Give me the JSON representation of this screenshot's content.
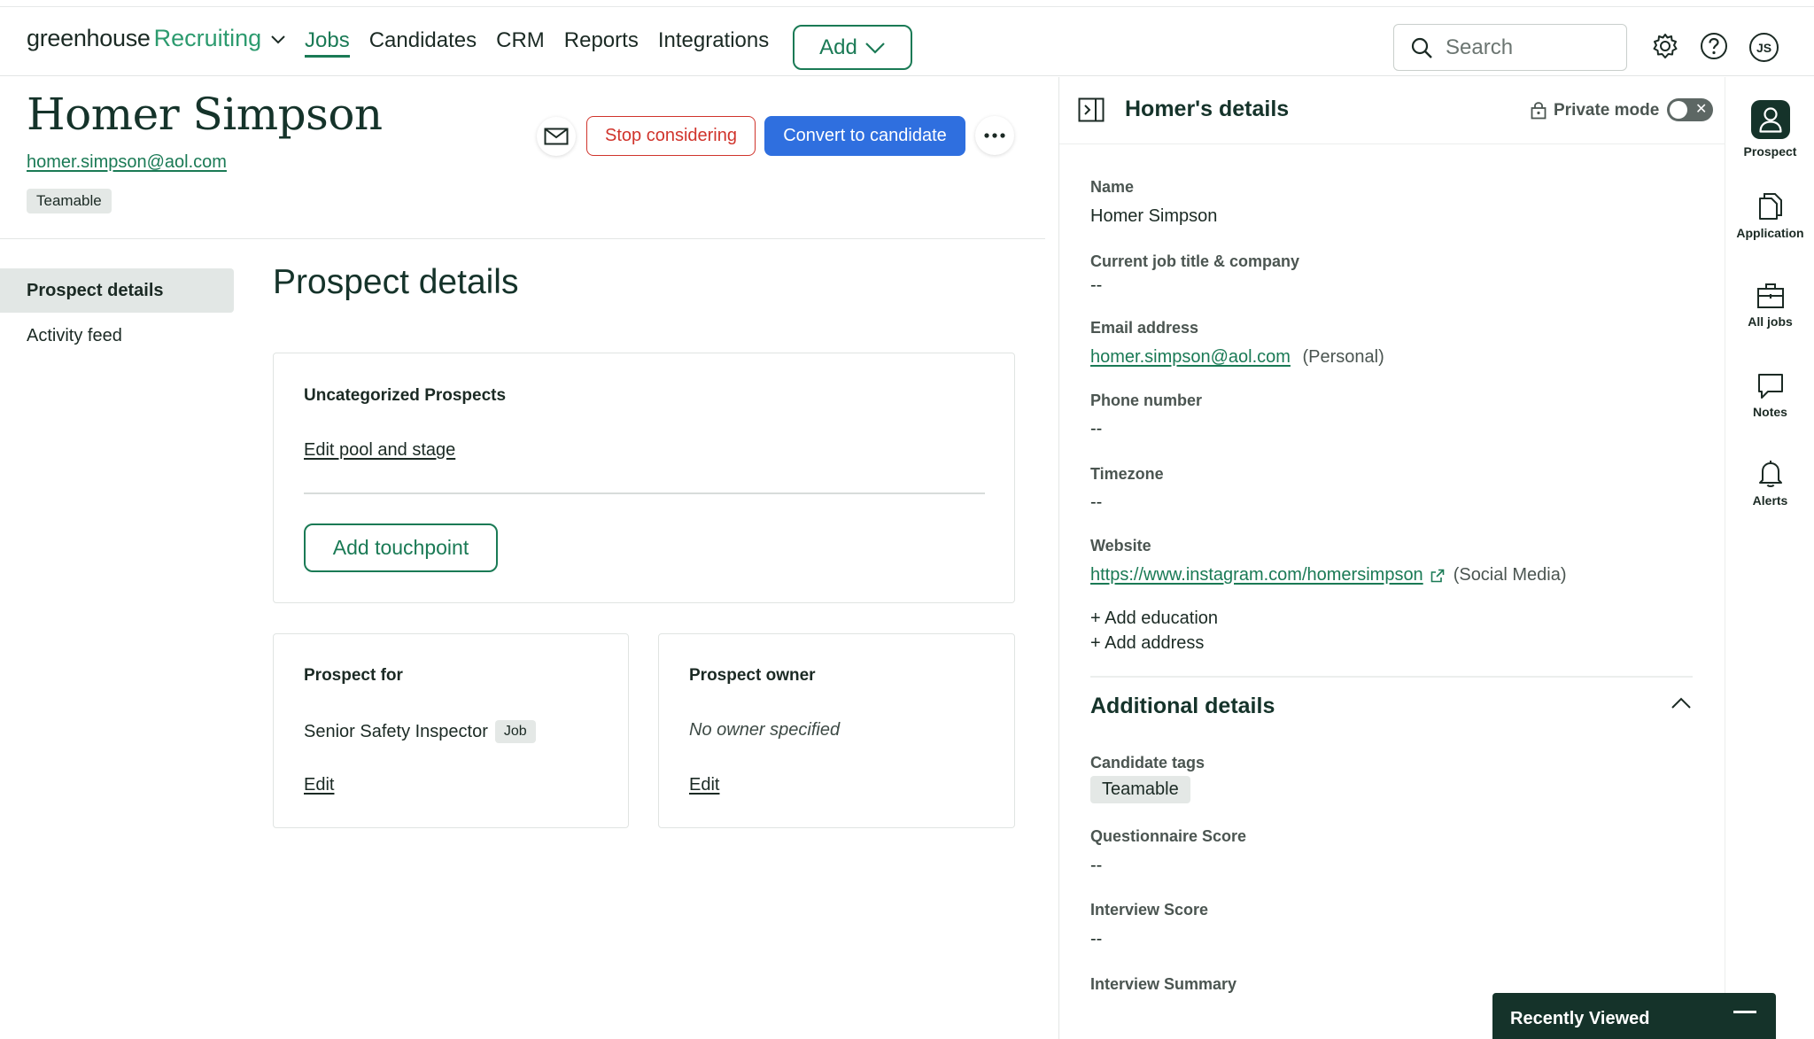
{
  "brand": {
    "name": "greenhouse",
    "product": "Recruiting"
  },
  "nav": {
    "items": [
      {
        "label": "Jobs",
        "active": true
      },
      {
        "label": "Candidates"
      },
      {
        "label": "CRM"
      },
      {
        "label": "Reports"
      },
      {
        "label": "Integrations"
      }
    ],
    "add_label": "Add",
    "search_placeholder": "Search",
    "user_initials": "JS"
  },
  "header": {
    "name": "Homer Simpson",
    "email": "homer.simpson@aol.com",
    "tag": "Teamable",
    "stop_label": "Stop considering",
    "convert_label": "Convert to candidate"
  },
  "subnav": {
    "items": [
      {
        "label": "Prospect details",
        "active": true
      },
      {
        "label": "Activity feed"
      }
    ]
  },
  "main": {
    "title": "Prospect details",
    "pool_card": {
      "title": "Uncategorized Prospects",
      "edit_link": "Edit pool and stage",
      "touchpoint_label": "Add touchpoint"
    },
    "prospect_for": {
      "title": "Prospect for",
      "job": "Senior Safety Inspector",
      "job_tag": "Job",
      "edit_link": "Edit"
    },
    "prospect_owner": {
      "title": "Prospect owner",
      "value": "No owner specified",
      "edit_link": "Edit"
    }
  },
  "details_panel": {
    "title": "Homer's details",
    "private_mode_label": "Private mode",
    "fields": {
      "name_label": "Name",
      "name_value": "Homer Simpson",
      "job_label": "Current job title & company",
      "job_value": "--",
      "email_label": "Email address",
      "email_value": "homer.simpson@aol.com",
      "email_type": "(Personal)",
      "phone_label": "Phone number",
      "phone_value": "--",
      "timezone_label": "Timezone",
      "timezone_value": "--",
      "website_label": "Website",
      "website_value": "https://www.instagram.com/homersimpson",
      "website_type": "(Social Media)"
    },
    "add_education": "+ Add education",
    "add_address": "+ Add address",
    "additional": {
      "title": "Additional details",
      "tags_label": "Candidate tags",
      "tag_value": "Teamable",
      "questionnaire_label": "Questionnaire Score",
      "questionnaire_value": "--",
      "interview_label": "Interview Score",
      "interview_value": "--",
      "summary_label": "Interview Summary"
    }
  },
  "rail": {
    "items": [
      {
        "label": "Prospect",
        "icon": "person-icon"
      },
      {
        "label": "Application",
        "icon": "documents-icon"
      },
      {
        "label": "All jobs",
        "icon": "briefcase-icon"
      },
      {
        "label": "Notes",
        "icon": "speech-bubble-icon"
      },
      {
        "label": "Alerts",
        "icon": "bell-icon"
      }
    ]
  },
  "recently_viewed": {
    "label": "Recently Viewed"
  },
  "colors": {
    "accent": "#1a7a55",
    "primary_button": "#2f6fdf",
    "danger": "#d0342c",
    "dark_green": "#15332a"
  }
}
